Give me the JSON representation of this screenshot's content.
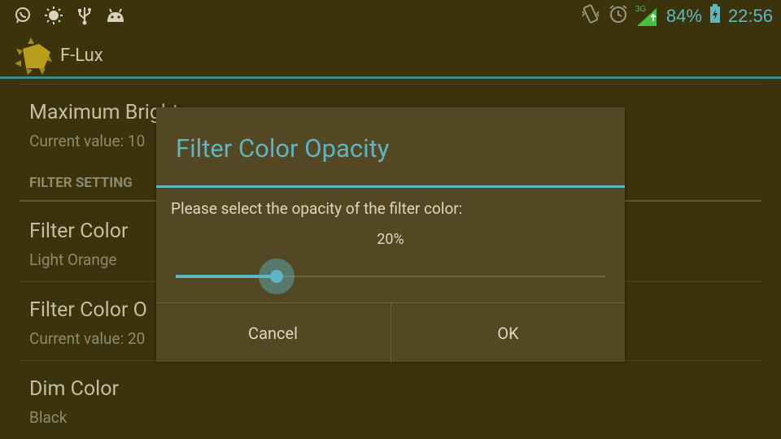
{
  "status_bar": {
    "left_icons": [
      "whatsapp-icon",
      "brightness-icon",
      "usb-icon",
      "android-debug-icon"
    ],
    "network_label": "3G",
    "battery_percent": "84%",
    "time": "22:56"
  },
  "app": {
    "title": "F-Lux"
  },
  "settings": {
    "maximum_brightness": {
      "title": "Maximum Bright",
      "summary": "Current value: 10"
    },
    "section_filter": "FILTER SETTING",
    "filter_color": {
      "title": "Filter Color",
      "summary": "Light Orange"
    },
    "filter_color_opacity": {
      "title": "Filter Color O",
      "summary": "Current value: 20"
    },
    "dim_color": {
      "title": "Dim Color",
      "summary": "Black"
    }
  },
  "dialog": {
    "title": "Filter Color Opacity",
    "message": "Please select the opacity of the filter color:",
    "value_label": "20%",
    "slider_fraction": 0.235,
    "cancel_label": "Cancel",
    "ok_label": "OK"
  },
  "colors": {
    "accent": "#5fb4c4",
    "background": "#3a330c",
    "dialog_bg": "#534823"
  }
}
